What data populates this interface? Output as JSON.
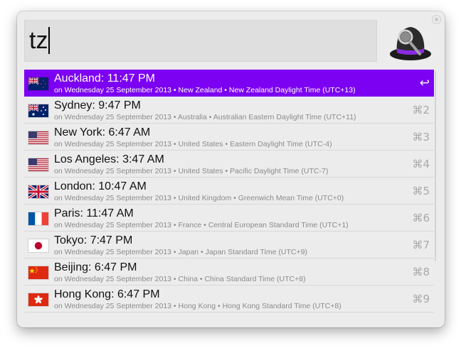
{
  "search": {
    "query": "tz"
  },
  "results": [
    {
      "title": "Auckland: 11:47 PM",
      "subtitle": "on Wednesday 25 September 2013  •  New Zealand • New Zealand Daylight Time (UTC+13)",
      "shortcut": "↩",
      "flag": "nz",
      "selected": true
    },
    {
      "title": "Sydney: 9:47 PM",
      "subtitle": "on Wednesday 25 September 2013  •  Australia • Australian Eastern Daylight Time (UTC+11)",
      "shortcut": "⌘2",
      "flag": "au"
    },
    {
      "title": "New York: 6:47 AM",
      "subtitle": "on Wednesday 25 September 2013  •  United States • Eastern Daylight Time (UTC-4)",
      "shortcut": "⌘3",
      "flag": "us"
    },
    {
      "title": "Los Angeles: 3:47 AM",
      "subtitle": "on Wednesday 25 September 2013  •  United States • Pacific Daylight Time (UTC-7)",
      "shortcut": "⌘4",
      "flag": "us"
    },
    {
      "title": "London: 10:47 AM",
      "subtitle": "on Wednesday 25 September 2013  •  United Kingdom • Greenwich Mean Time (UTC+0)",
      "shortcut": "⌘5",
      "flag": "uk"
    },
    {
      "title": "Paris: 11:47 AM",
      "subtitle": "on Wednesday 25 September 2013  •  France • Central European Standard Time (UTC+1)",
      "shortcut": "⌘6",
      "flag": "fr"
    },
    {
      "title": "Tokyo: 7:47 PM",
      "subtitle": "on Wednesday 25 September 2013  •  Japan • Japan Standard Time (UTC+9)",
      "shortcut": "⌘7",
      "flag": "jp"
    },
    {
      "title": "Beijing: 6:47 PM",
      "subtitle": "on Wednesday 25 September 2013  •  China • China Standard Time (UTC+8)",
      "shortcut": "⌘8",
      "flag": "cn"
    },
    {
      "title": "Hong Kong: 6:47 PM",
      "subtitle": "on Wednesday 25 September 2013  •  Hong Kong • Hong Kong Standard Time (UTC+8)",
      "shortcut": "⌘9",
      "flag": "hk"
    }
  ],
  "colors": {
    "selection": "#7c00f2",
    "window": "#ececec"
  },
  "icons": {
    "app_logo": "alfred-hat-icon",
    "settings": "gear-icon"
  }
}
